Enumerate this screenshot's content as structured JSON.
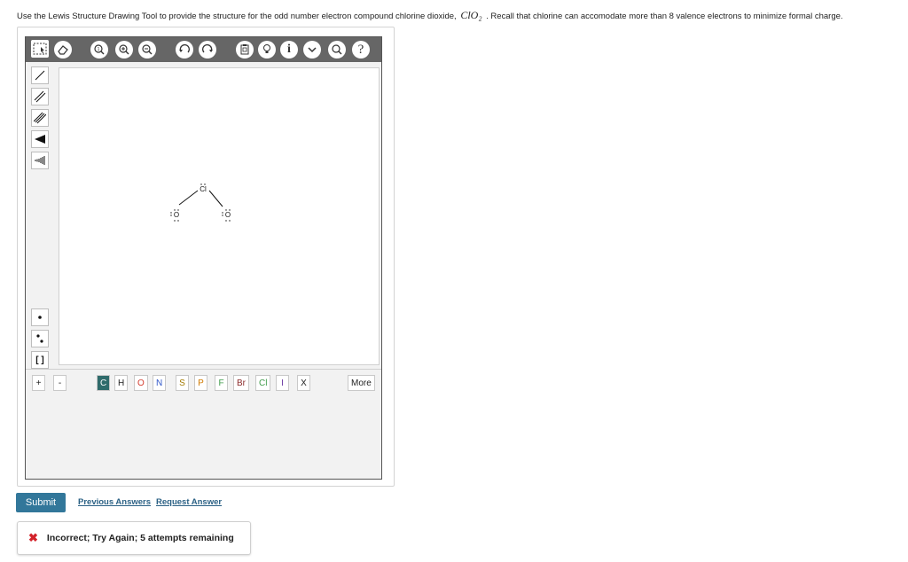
{
  "prompt": {
    "text_before": "Use the Lewis Structure Drawing Tool to provide the structure for the odd number electron compound chlorine dioxide,",
    "formula": "ClO₂",
    "text_after": ". Recall that chlorine can accomodate more than 8 valence electrons to minimize formal charge."
  },
  "toolbar": {
    "question_mark": "?",
    "info": "i"
  },
  "leftbar": {
    "bracket": "[ ]"
  },
  "molecule": {
    "atoms": [
      {
        "symbol": "Cl",
        "role": "center"
      },
      {
        "symbol": "O",
        "role": "left"
      },
      {
        "symbol": "O",
        "role": "right"
      }
    ],
    "bonds": [
      [
        "Cl",
        "O"
      ],
      [
        "Cl",
        "O"
      ]
    ]
  },
  "bottombar": {
    "charge_plus": "+",
    "charge_minus": "-",
    "elements": [
      {
        "label": "C",
        "color": "#ffffff",
        "bg": "#2f6b6b"
      },
      {
        "label": "H",
        "color": "#222222",
        "bg": "#ffffff"
      },
      {
        "label": "O",
        "color": "#d33a2c",
        "bg": "#ffffff"
      },
      {
        "label": "N",
        "color": "#2f56c9",
        "bg": "#ffffff"
      },
      {
        "label": "S",
        "color": "#a37a00",
        "bg": "#ffffff"
      },
      {
        "label": "P",
        "color": "#d17a00",
        "bg": "#ffffff"
      },
      {
        "label": "F",
        "color": "#3f9b4a",
        "bg": "#ffffff"
      },
      {
        "label": "Br",
        "color": "#8a2a2a",
        "bg": "#ffffff"
      },
      {
        "label": "Cl",
        "color": "#3f9b4a",
        "bg": "#ffffff"
      },
      {
        "label": "I",
        "color": "#6b3aa3",
        "bg": "#ffffff"
      },
      {
        "label": "X",
        "color": "#222222",
        "bg": "#ffffff"
      }
    ],
    "more_label": "More"
  },
  "actions": {
    "submit_label": "Submit",
    "previous_answers_label": "Previous Answers",
    "request_answer_label": "Request Answer"
  },
  "feedback": {
    "icon": "✖",
    "message": "Incorrect; Try Again; 5 attempts remaining"
  }
}
